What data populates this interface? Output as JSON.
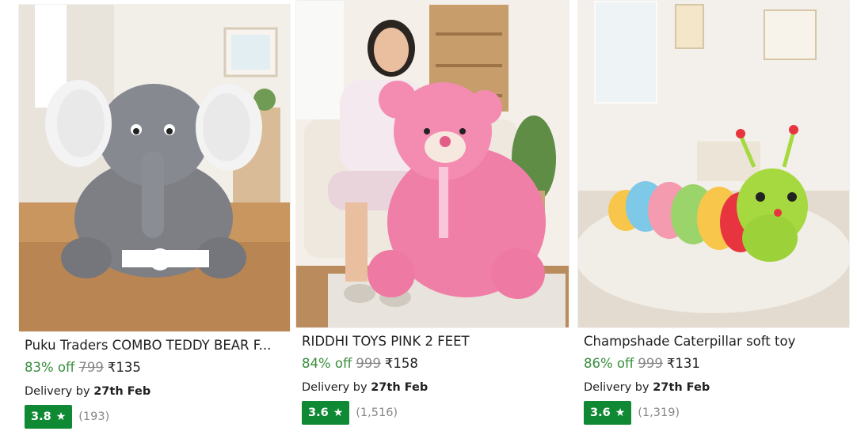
{
  "products": [
    {
      "title": "Puku Traders COMBO TEDDY BEAR F...",
      "discount": "83% off",
      "mrp": "799",
      "price": "₹135",
      "delivery_prefix": "Delivery by",
      "delivery_date": "27th Feb",
      "rating": "3.8",
      "rating_count": "(193)",
      "image_icon": "elephant-plush-photo"
    },
    {
      "title": "RIDDHI TOYS PINK 2 FEET",
      "discount": "84% off",
      "mrp": "999",
      "price": "₹158",
      "delivery_prefix": "Delivery by",
      "delivery_date": "27th Feb",
      "rating": "3.6",
      "rating_count": "(1,516)",
      "image_icon": "pink-teddy-photo"
    },
    {
      "title": "Champshade Caterpillar soft toy",
      "discount": "86% off",
      "mrp": "999",
      "price": "₹131",
      "delivery_prefix": "Delivery by",
      "delivery_date": "27th Feb",
      "rating": "3.6",
      "rating_count": "(1,319)",
      "image_icon": "caterpillar-plush-photo"
    }
  ],
  "star_glyph": "★",
  "colors": {
    "discount": "#388e3c",
    "rating_badge": "#108934",
    "mrp": "#878787"
  }
}
